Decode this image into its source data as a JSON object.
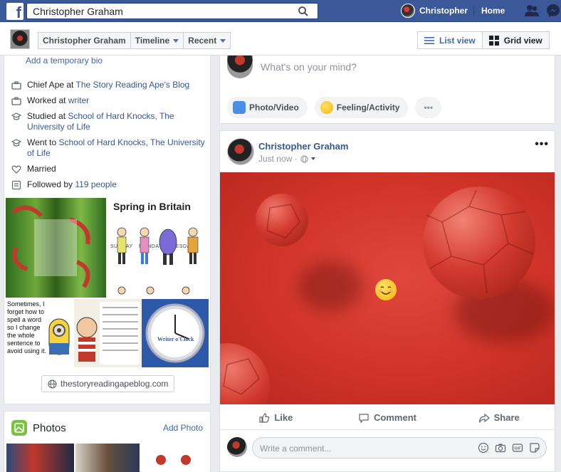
{
  "topbar": {
    "logo_letter": "f",
    "search_value": "Christopher Graham",
    "profile_name": "Christopher",
    "home_label": "Home"
  },
  "subbar": {
    "name_button": "Christopher Graham",
    "timeline_button": "Timeline",
    "recent_button": "Recent",
    "list_view": "List view",
    "grid_view": "Grid view"
  },
  "intro": {
    "temp_bio": "Add a temporary bio",
    "items": [
      {
        "prefix": "Chief Ape at ",
        "link": "The Story Reading Ape's Blog",
        "suffix": ""
      },
      {
        "prefix": "Worked at ",
        "link": "writer",
        "suffix": ""
      },
      {
        "prefix": "Studied at ",
        "link": "School of Hard Knocks, The University of Life",
        "suffix": ""
      },
      {
        "prefix": "Went to ",
        "link": "School of Hard Knocks, The University of Life",
        "suffix": ""
      },
      {
        "prefix": "Married",
        "link": "",
        "suffix": ""
      },
      {
        "prefix": "Followed by ",
        "link": "119 people",
        "suffix": ""
      }
    ],
    "tiles": {
      "spring": "Spring in Britain",
      "days": "SUNDAY MONDAY TUESDAY WEDNESDAY THURSDAY FRIDAY SATURDAY",
      "sometimes": "Sometimes, I forget how to spell a word so I change the whole sentence to avoid using it.",
      "clock": "Writer o'Clock"
    },
    "website": "thestoryreadingapeblog.com"
  },
  "photos": {
    "title": "Photos",
    "add": "Add Photo"
  },
  "composer": {
    "placeholder": "What's on your mind?",
    "photo_video": "Photo/Video",
    "feeling": "Feeling/Activity",
    "more": "•••"
  },
  "post": {
    "author": "Christopher Graham",
    "time": "Just now ·",
    "more": "•••",
    "like": "Like",
    "comment": "Comment",
    "share": "Share",
    "comment_placeholder": "Write a comment..."
  }
}
